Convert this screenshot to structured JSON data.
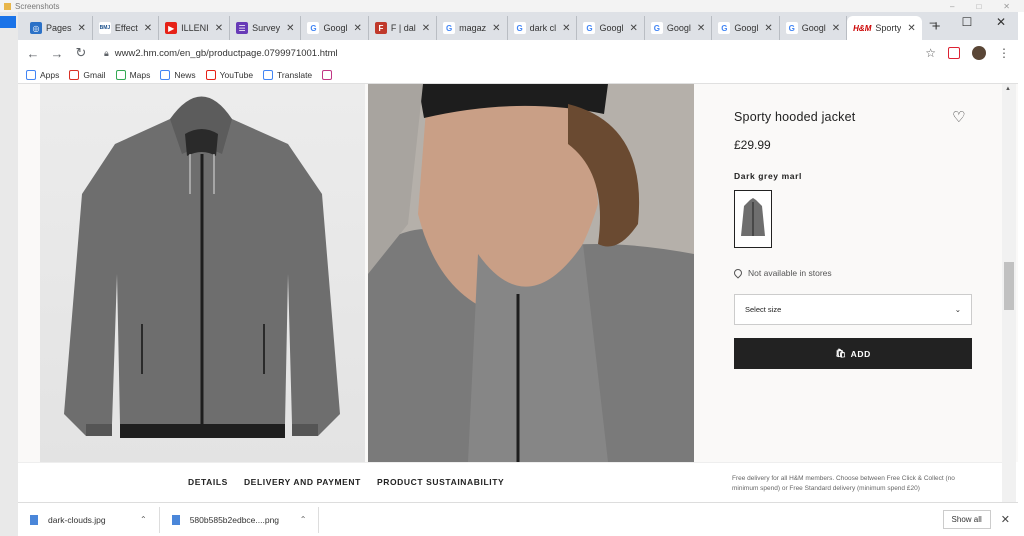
{
  "explorer": {
    "title": "Screenshots"
  },
  "browser": {
    "tabs": [
      {
        "title": "Pages",
        "favicon_color": "#2b71c7",
        "favicon_glyph": "◎"
      },
      {
        "title": "Effect",
        "favicon_color": "#ffffff",
        "favicon_glyph": "BMJ"
      },
      {
        "title": "ILLENI",
        "favicon_color": "#e62117",
        "favicon_glyph": "▶"
      },
      {
        "title": "Survey",
        "favicon_color": "#673ab7",
        "favicon_glyph": "☰"
      },
      {
        "title": "Googl",
        "favicon_color": "#ffffff",
        "favicon_glyph": "G"
      },
      {
        "title": "F | dal",
        "favicon_color": "#c0392b",
        "favicon_glyph": "F"
      },
      {
        "title": "magaz",
        "favicon_color": "#ffffff",
        "favicon_glyph": "G"
      },
      {
        "title": "dark cl",
        "favicon_color": "#ffffff",
        "favicon_glyph": "G"
      },
      {
        "title": "Googl",
        "favicon_color": "#ffffff",
        "favicon_glyph": "G"
      },
      {
        "title": "Googl",
        "favicon_color": "#ffffff",
        "favicon_glyph": "G"
      },
      {
        "title": "Googl",
        "favicon_color": "#ffffff",
        "favicon_glyph": "G"
      },
      {
        "title": "Googl",
        "favicon_color": "#ffffff",
        "favicon_glyph": "G"
      }
    ],
    "active_tab": {
      "title": "Sporty",
      "favicon_glyph": "H&M"
    },
    "new_tab": "+",
    "url": "www2.hm.com/en_gb/productpage.0799971001.html",
    "bookmarks": [
      {
        "label": "Apps",
        "icon": "apps-icon",
        "color": "#4285f4"
      },
      {
        "label": "Gmail",
        "icon": "gmail-icon",
        "color": "#d93025"
      },
      {
        "label": "Maps",
        "icon": "maps-icon",
        "color": "#34a853"
      },
      {
        "label": "News",
        "icon": "news-icon",
        "color": "#4285f4"
      },
      {
        "label": "YouTube",
        "icon": "youtube-icon",
        "color": "#e62117"
      },
      {
        "label": "Translate",
        "icon": "translate-icon",
        "color": "#4285f4"
      },
      {
        "label": "",
        "icon": "instagram-icon",
        "color": "#c13584"
      }
    ]
  },
  "product": {
    "title": "Sporty hooded jacket",
    "price": "£29.99",
    "color": "Dark grey marl",
    "availability": "Not available in stores",
    "size_placeholder": "Select size",
    "add_label": "ADD"
  },
  "details": {
    "links": [
      "DETAILS",
      "DELIVERY AND PAYMENT",
      "PRODUCT SUSTAINABILITY"
    ],
    "delivery_text": "Free delivery for all H&M members. Choose between Free Click & Collect (no minimum spend) or Free Standard delivery (minimum spend £20)"
  },
  "downloads": {
    "items": [
      "dark-clouds.jpg",
      "580b585b2edbce....png"
    ],
    "show_all": "Show all"
  },
  "colors": {
    "add_button": "#222222",
    "page_bg": "#faf9f8",
    "jacket": "#6b6b6b"
  }
}
